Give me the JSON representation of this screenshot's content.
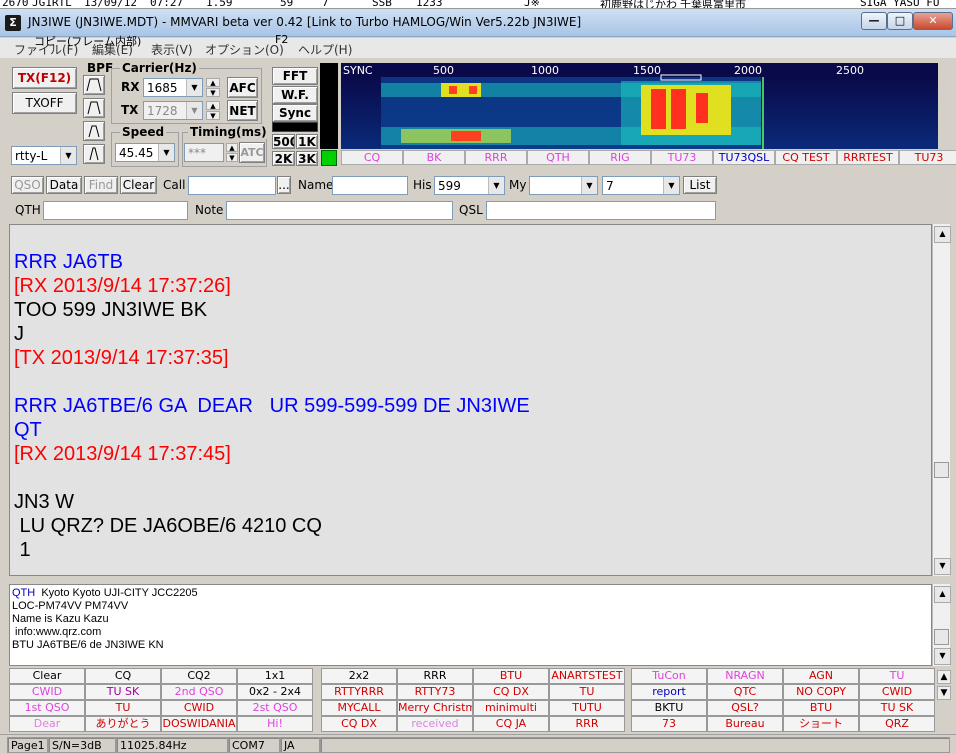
{
  "background_app": {
    "strip": [
      {
        "text": "2670",
        "color": "#000000"
      },
      {
        "text": "JG1RTL",
        "color": "#000000"
      },
      {
        "text": "13/09/12",
        "color": "#000000"
      },
      {
        "text": "07:27",
        "color": "#000000"
      },
      {
        "text": "1.59",
        "color": "#000000"
      },
      {
        "text": "59",
        "color": "#000000"
      },
      {
        "text": "7",
        "color": "#000000"
      },
      {
        "text": "SSB",
        "color": "#000000"
      },
      {
        "text": "1233",
        "color": "#000000"
      },
      {
        "text": "J※",
        "color": "#000000"
      },
      {
        "text": "初鹿野はじかわ",
        "color": "#000000"
      },
      {
        "text": "千葉県富里市",
        "color": "#000000"
      },
      {
        "text": "SIGA YASU FU",
        "color": "#000000"
      }
    ]
  },
  "window": {
    "title": "JN3IWE (JN3IWE.MDT) - MMVARI beta ver 0.42 [Link to Turbo HAMLOG/Win Ver5.22b JN3IWE]",
    "app_icon": "Σ",
    "minimize_icon": "—",
    "maximize_icon": "□",
    "close_icon": "✕"
  },
  "menubar": {
    "items": [
      "ファイル(F)",
      "編集(E)",
      "表示(V)",
      "オプション(O)",
      "ヘルプ(H)"
    ],
    "tooltip_copy": "コピー(フレーム内部)",
    "tooltip_key": "F2"
  },
  "controls": {
    "tx_button": "TX(F12)",
    "txoff_button": "TXOFF",
    "bpf_label": "BPF",
    "mode_select": "rtty-L",
    "carrier_label": "Carrier(Hz)",
    "rx_label": "RX",
    "rx_value": "1685",
    "tx_label": "TX",
    "tx_value": "1728",
    "afc_button": "AFC",
    "net_button": "NET",
    "speed_label": "Speed",
    "speed_value": "45.45",
    "timing_label": "Timing(ms)",
    "timing_value": "***",
    "atc_button": "ATC",
    "fft_button": "FFT",
    "wf_button": "W.F.",
    "sync_button": "Sync",
    "bw_500": "500",
    "bw_1k": "1K",
    "bw_2k": "2K",
    "bw_3k": "3K"
  },
  "waterfall": {
    "sync_label": "SYNC",
    "ticks": [
      "500",
      "1000",
      "1500",
      "2000",
      "2500"
    ],
    "macros": [
      {
        "label": "CQ",
        "color": "#e040e0"
      },
      {
        "label": "BK",
        "color": "#e040e0"
      },
      {
        "label": "RRR",
        "color": "#e040e0"
      },
      {
        "label": "QTH",
        "color": "#e040e0"
      },
      {
        "label": "RIG",
        "color": "#e040e0"
      },
      {
        "label": "TU73",
        "color": "#e040e0"
      },
      {
        "label": "TU73QSL",
        "color": "#0000c0"
      },
      {
        "label": "CQ TEST",
        "color": "#d00000"
      },
      {
        "label": "RRRTEST",
        "color": "#d00000"
      },
      {
        "label": "TU73",
        "color": "#d00000"
      }
    ]
  },
  "qso": {
    "qso_button": "QSO",
    "data_button": "Data",
    "find_button": "Find",
    "clear_button": "Clear",
    "call_label": "Call",
    "call_value": "",
    "lookup_button": "...",
    "name_label": "Name",
    "name_value": "",
    "his_label": "His",
    "his_value": "599",
    "my_label": "My",
    "my_value": "",
    "band_value": "7",
    "list_button": "List",
    "qth_label": "QTH",
    "qth_value": "",
    "note_label": "Note",
    "note_value": "",
    "qsl_label": "QSL",
    "qsl_value": ""
  },
  "rx_text": [
    {
      "text": "RRR JA6TB",
      "color": "#0000ff"
    },
    {
      "text": "[RX 2013/9/14 17:37:26]",
      "color": "#ff0000"
    },
    {
      "text": "TOO 599 JN3IWE BK",
      "color": "#000000"
    },
    {
      "text": "J",
      "color": "#000000"
    },
    {
      "text": "[TX 2013/9/14 17:37:35]",
      "color": "#ff0000"
    },
    {
      "text": "",
      "color": "#000000"
    },
    {
      "text": "RRR JA6TBE/6 GA  DEAR   UR 599-599-599 DE JN3IWE",
      "color": "#0000ff"
    },
    {
      "text": "QT",
      "color": "#0000ff"
    },
    {
      "text": "[RX 2013/9/14 17:37:45]",
      "color": "#ff0000"
    },
    {
      "text": "",
      "color": "#000000"
    },
    {
      "text": "JN3 W",
      "color": "#000000"
    },
    {
      "text": " LU QRZ? DE JA6OBE/6 4210 CQ",
      "color": "#000000"
    },
    {
      "text": " 1",
      "color": "#000000"
    }
  ],
  "tx_text": [
    {
      "prefix": "QTH",
      "text": "  Kyoto Kyoto UJI-CITY JCC2205"
    },
    {
      "prefix": "",
      "text": "LOC-PM74VV PM74VV"
    },
    {
      "prefix": "",
      "text": "Name is Kazu Kazu"
    },
    {
      "prefix": "",
      "text": " info:www.qrz.com"
    },
    {
      "prefix": "",
      "text": "BTU JA6TBE/6 de JN3IWE KN"
    }
  ],
  "macro_grid": [
    [
      {
        "label": "Clear",
        "color": "#000000"
      },
      {
        "label": "CQ",
        "color": "#000000"
      },
      {
        "label": "CQ2",
        "color": "#000000"
      },
      {
        "label": "1x1",
        "color": "#000000"
      },
      {
        "label": "2x2",
        "color": "#000000"
      },
      {
        "label": "RRR",
        "color": "#000000"
      },
      {
        "label": "BTU",
        "color": "#d00000"
      },
      {
        "label": "ANARTSTEST",
        "color": "#d00000"
      },
      {
        "label": "TuCon",
        "color": "#e040e0"
      },
      {
        "label": "NRAGN",
        "color": "#e040e0"
      },
      {
        "label": "AGN",
        "color": "#d00000"
      },
      {
        "label": "TU",
        "color": "#e040e0"
      }
    ],
    [
      {
        "label": "CWID",
        "color": "#e040e0"
      },
      {
        "label": "TU SK",
        "color": "#a000a0"
      },
      {
        "label": "2nd QSO",
        "color": "#e040e0"
      },
      {
        "label": "0x2 - 2x4",
        "color": "#000000"
      },
      {
        "label": "RTTYRRR",
        "color": "#d00000"
      },
      {
        "label": "RTTY73",
        "color": "#d00000"
      },
      {
        "label": "CQ DX",
        "color": "#d00000"
      },
      {
        "label": "TU",
        "color": "#d00000"
      },
      {
        "label": "report",
        "color": "#0000c0"
      },
      {
        "label": "QTC",
        "color": "#d00000"
      },
      {
        "label": "NO COPY",
        "color": "#d00000"
      },
      {
        "label": "CWID",
        "color": "#d00000"
      }
    ],
    [
      {
        "label": "1st QSO",
        "color": "#e040e0"
      },
      {
        "label": "TU",
        "color": "#d00000"
      },
      {
        "label": "CWID",
        "color": "#d00000"
      },
      {
        "label": "2st QSO",
        "color": "#e040e0"
      },
      {
        "label": "MYCALL",
        "color": "#d00000"
      },
      {
        "label": "Merry Christmas",
        "color": "#d00000"
      },
      {
        "label": "minimulti",
        "color": "#d00000"
      },
      {
        "label": "TUTU",
        "color": "#d00000"
      },
      {
        "label": "BKTU",
        "color": "#000000"
      },
      {
        "label": "QSL?",
        "color": "#d00000"
      },
      {
        "label": "BTU",
        "color": "#d00000"
      },
      {
        "label": "TU SK",
        "color": "#d00000"
      }
    ],
    [
      {
        "label": "Dear",
        "color": "#e080e0"
      },
      {
        "label": "ありがとう",
        "color": "#d00000"
      },
      {
        "label": "DOSWIDANIA",
        "color": "#d00000"
      },
      {
        "label": "Hi!",
        "color": "#e040e0"
      },
      {
        "label": "CQ DX",
        "color": "#d00000"
      },
      {
        "label": "received",
        "color": "#e080e0"
      },
      {
        "label": "CQ JA",
        "color": "#d00000"
      },
      {
        "label": "RRR",
        "color": "#d00000"
      },
      {
        "label": "73",
        "color": "#d00000"
      },
      {
        "label": "Bureau",
        "color": "#d00000"
      },
      {
        "label": "ショート",
        "color": "#d00000"
      },
      {
        "label": "QRZ",
        "color": "#d00000"
      }
    ]
  ],
  "statusbar": {
    "page": "Page1",
    "sn": "S/N=3dB",
    "clock": "11025.84Hz",
    "port": "COM7",
    "lang": "JA"
  }
}
